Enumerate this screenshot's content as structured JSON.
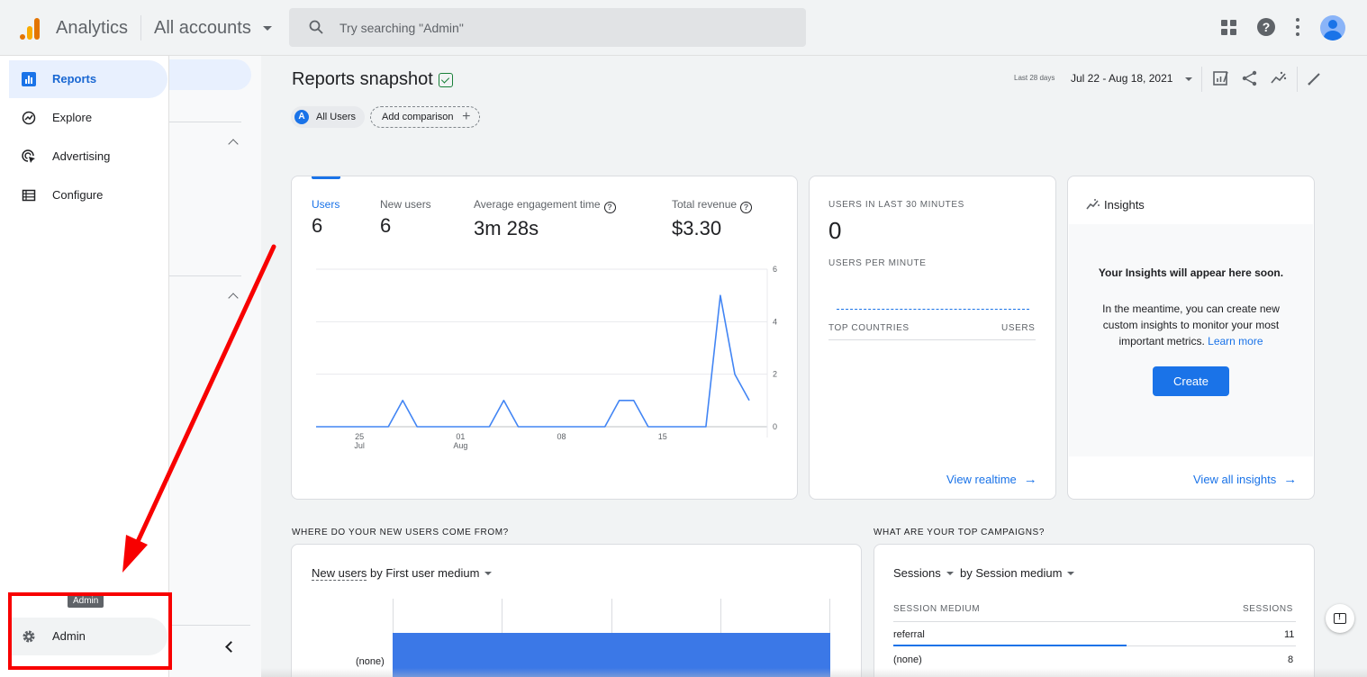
{
  "header": {
    "app_name": "Analytics",
    "account": "All accounts",
    "search_placeholder": "Try searching \"Admin\""
  },
  "sidebar": {
    "items": [
      {
        "label": "Reports",
        "icon": "bar-chart-icon"
      },
      {
        "label": "Explore",
        "icon": "explore-icon"
      },
      {
        "label": "Advertising",
        "icon": "advertising-icon"
      },
      {
        "label": "Configure",
        "icon": "configure-icon"
      }
    ],
    "admin_label": "Admin",
    "admin_tooltip": "Admin"
  },
  "page": {
    "title": "Reports snapshot",
    "segment_chip": "All Users",
    "segment_initial": "A",
    "add_comparison": "Add comparison",
    "date_prefix": "Last 28 days",
    "date_range": "Jul 22 - Aug 18, 2021"
  },
  "overview": {
    "metrics": [
      {
        "label": "Users",
        "value": "6"
      },
      {
        "label": "New users",
        "value": "6"
      },
      {
        "label": "Average engagement time",
        "value": "3m 28s"
      },
      {
        "label": "Total revenue",
        "value": "$3.30"
      }
    ]
  },
  "chart_data": {
    "type": "line",
    "x_ticks": [
      {
        "label": "25",
        "sublabel": "Jul",
        "index": 3
      },
      {
        "label": "01",
        "sublabel": "Aug",
        "index": 10
      },
      {
        "label": "08",
        "sublabel": "",
        "index": 17
      },
      {
        "label": "15",
        "sublabel": "",
        "index": 24
      }
    ],
    "y_ticks": [
      0,
      2,
      4,
      6
    ],
    "ylim": [
      0,
      6
    ],
    "series": [
      {
        "values": [
          0,
          0,
          0,
          0,
          0,
          0,
          1,
          0,
          0,
          0,
          0,
          0,
          0,
          1,
          0,
          0,
          0,
          0,
          0,
          0,
          0,
          1,
          1,
          0,
          0,
          0,
          0,
          0,
          5,
          2,
          1
        ]
      }
    ],
    "colors": {
      "line": "#4285f4"
    }
  },
  "realtime": {
    "heading": "USERS IN LAST 30 MINUTES",
    "value": "0",
    "per_minute": "USERS PER MINUTE",
    "countries_col": "TOP COUNTRIES",
    "users_col": "USERS",
    "link": "View realtime"
  },
  "insights": {
    "title": "Insights",
    "heading": "Your Insights will appear here soon.",
    "body": "In the meantime, you can create new custom insights to monitor your most important metrics.",
    "learn_more": "Learn more",
    "create": "Create",
    "link": "View all insights"
  },
  "new_users": {
    "section_title": "WHERE DO YOUR NEW USERS COME FROM?",
    "metric": "New users",
    "dimension": "by First user medium",
    "bar_label": "(none)"
  },
  "campaigns": {
    "section_title": "WHAT ARE YOUR TOP CAMPAIGNS?",
    "metric": "Sessions",
    "dimension": "by Session medium",
    "col_medium": "SESSION MEDIUM",
    "col_sessions": "SESSIONS",
    "rows": [
      {
        "medium": "referral",
        "sessions": "11"
      },
      {
        "medium": "(none)",
        "sessions": "8"
      }
    ]
  },
  "colors": {
    "accent": "#1a73e8",
    "annotation": "#f80000"
  }
}
